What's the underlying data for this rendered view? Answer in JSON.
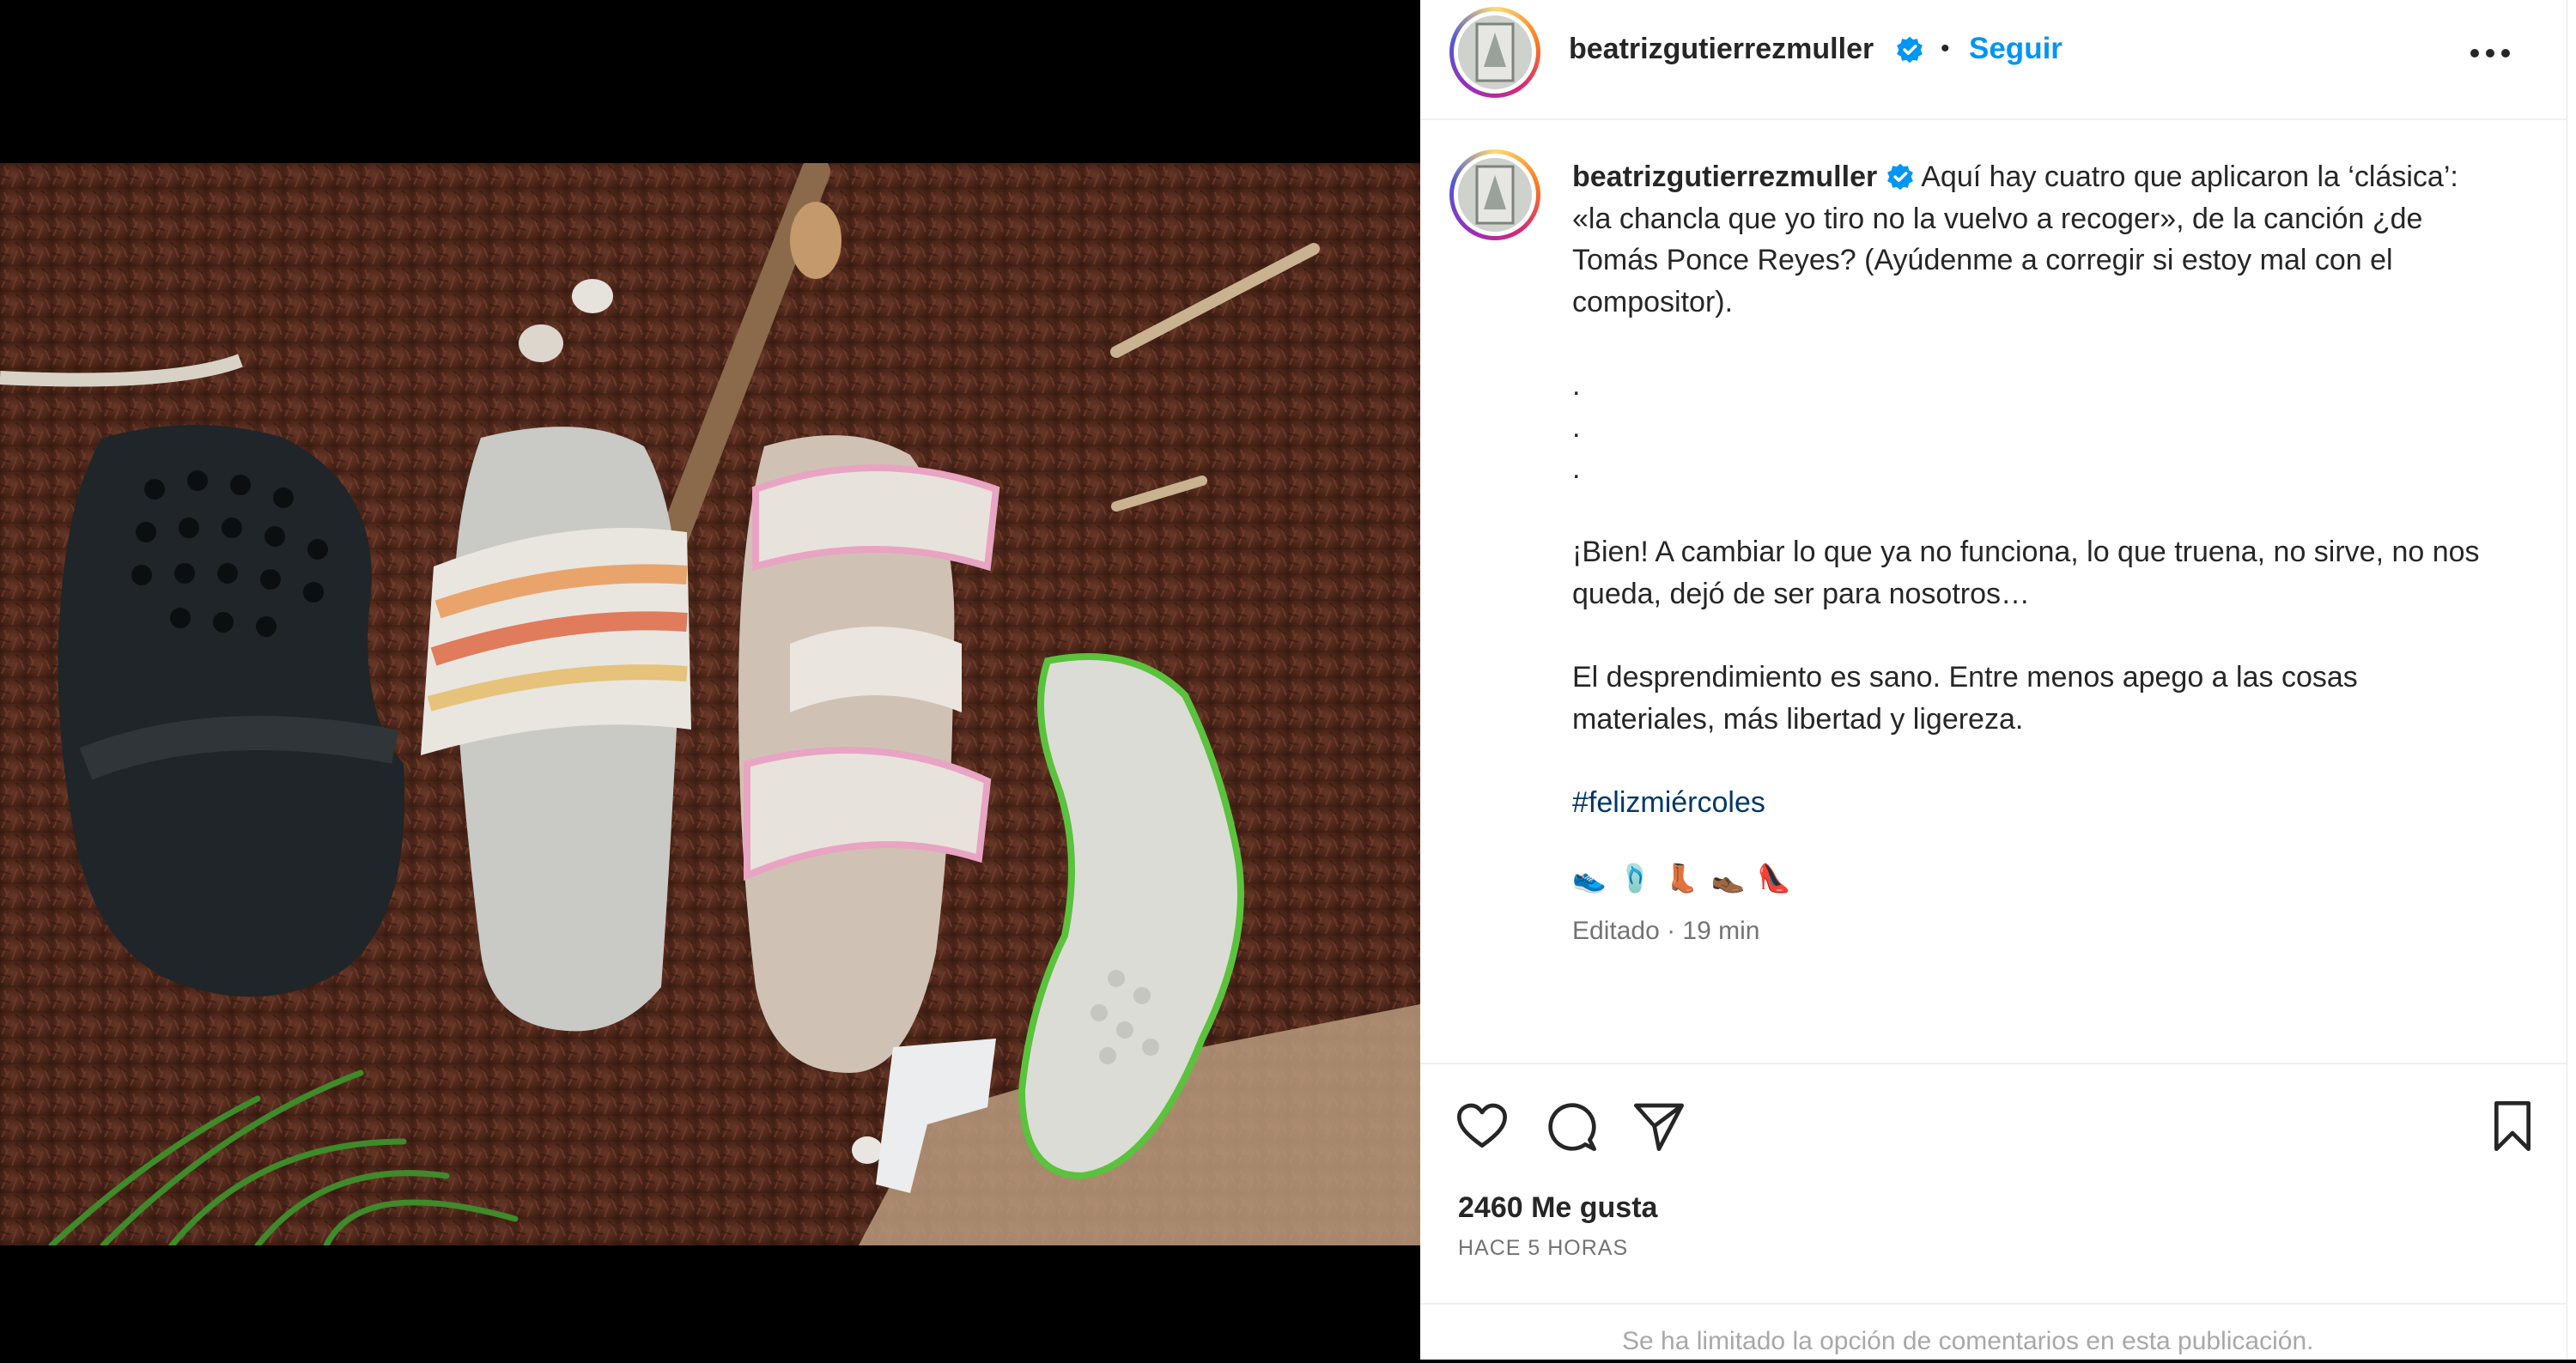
{
  "post": {
    "username": "beatrizgutierrezmuller",
    "follow_label": "Seguir",
    "separator": "•"
  },
  "caption": {
    "username": "beatrizgutierrezmuller",
    "paragraph1": "Aquí hay cuatro que aplicaron la ‘clásica’: «la chancla que yo tiro no la vuelvo a recoger», de la canción ¿de Tomás Ponce Reyes? (Ayúdenme a corregir si estoy mal con el compositor).",
    "dot1": ".",
    "dot2": ".",
    "dot3": ".",
    "paragraph2": "¡Bien! A cambiar lo que ya no funciona, lo que truena, no sirve, no nos queda, dejó de ser para nosotros…",
    "paragraph3": "El desprendimiento es sano. Entre menos apego a las cosas materiales, más libertad y ligereza.",
    "hashtag": "#felizmiércoles",
    "emojis": [
      "👟",
      "🩴",
      "👢",
      "👞",
      "👠"
    ],
    "meta": "Editado · 19 min"
  },
  "engagement": {
    "likes": "2460 Me gusta",
    "time_ago": "HACE 5 HORAS",
    "comment_hint": "Se ha limitado la opción de comentarios en esta publicación."
  },
  "icons": {
    "more": "more-options-icon",
    "like": "heart-icon",
    "comment": "comment-icon",
    "share": "paper-plane-icon",
    "save": "bookmark-icon",
    "verified": "verified-badge-icon"
  },
  "colors": {
    "link": "#0095f6",
    "hashtag": "#00376b",
    "verified": "#0095f6",
    "secondary_text": "#737373"
  }
}
